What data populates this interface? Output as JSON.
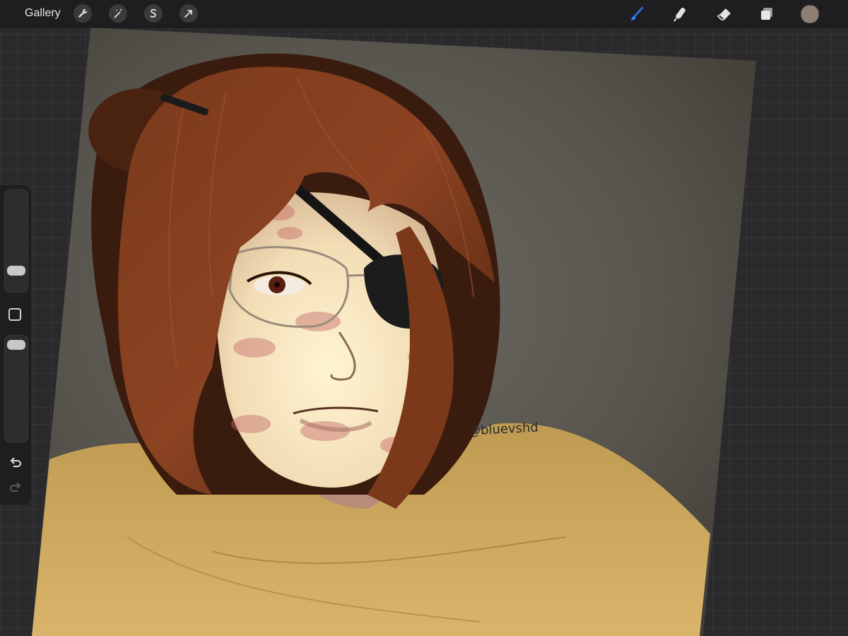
{
  "topbar": {
    "gallery_label": "Gallery",
    "actions_icon": "wrench-icon",
    "adjustments_icon": "magic-wand-icon",
    "selection_icon": "selection-s-icon",
    "transform_icon": "arrow-cursor-icon"
  },
  "tools": {
    "brush": "brush-icon",
    "smudge": "smudge-finger-icon",
    "eraser": "eraser-icon",
    "layers": "layers-icon",
    "active_tool": "brush",
    "current_color": "#8f7f72"
  },
  "colors": {
    "active_blue": "#2f7cf6"
  },
  "sidebar": {
    "brush_size_level": 0.25,
    "opacity_level": 1.0,
    "modify_icon": "square-modify-icon",
    "undo_icon": "undo-arrow-icon",
    "redo_icon": "redo-arrow-icon"
  },
  "artwork": {
    "signature_text": "@bluevshd"
  }
}
